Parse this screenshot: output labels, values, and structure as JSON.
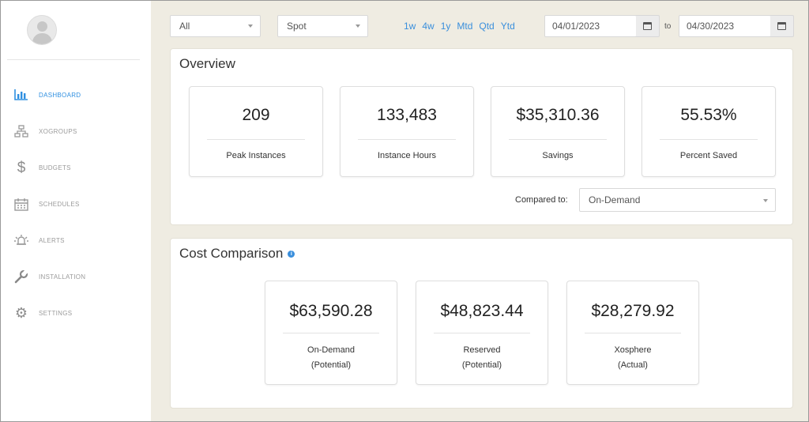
{
  "sidebar": {
    "items": [
      {
        "label": "DASHBOARD",
        "icon": "bar-chart-icon",
        "active": true
      },
      {
        "label": "XOGROUPS",
        "icon": "hierarchy-icon",
        "active": false
      },
      {
        "label": "BUDGETS",
        "icon": "dollar-icon",
        "active": false
      },
      {
        "label": "SCHEDULES",
        "icon": "calendar-icon",
        "active": false
      },
      {
        "label": "ALERTS",
        "icon": "alert-icon",
        "active": false
      },
      {
        "label": "INSTALLATION",
        "icon": "wrench-icon",
        "active": false
      },
      {
        "label": "SETTINGS",
        "icon": "gear-icon",
        "active": false
      }
    ]
  },
  "filters": {
    "group_select": "All",
    "type_select": "Spot",
    "ranges": [
      "1w",
      "4w",
      "1y",
      "Mtd",
      "Qtd",
      "Ytd"
    ],
    "start_date": "04/01/2023",
    "to_label": "to",
    "end_date": "04/30/2023"
  },
  "overview": {
    "title": "Overview",
    "cards": [
      {
        "value": "209",
        "label": "Peak Instances"
      },
      {
        "value": "133,483",
        "label": "Instance Hours"
      },
      {
        "value": "$35,310.36",
        "label": "Savings"
      },
      {
        "value": "55.53%",
        "label": "Percent Saved"
      }
    ],
    "compared_to_label": "Compared to:",
    "compared_to_value": "On-Demand"
  },
  "cost_comparison": {
    "title": "Cost Comparison",
    "info_glyph": "i",
    "cards": [
      {
        "value": "$63,590.28",
        "label_line1": "On-Demand",
        "label_line2": "(Potential)"
      },
      {
        "value": "$48,823.44",
        "label_line1": "Reserved",
        "label_line2": "(Potential)"
      },
      {
        "value": "$28,279.92",
        "label_line1": "Xosphere",
        "label_line2": "(Actual)"
      }
    ]
  },
  "colors": {
    "accent": "#2f8fe0",
    "main_bg": "#efece2"
  }
}
